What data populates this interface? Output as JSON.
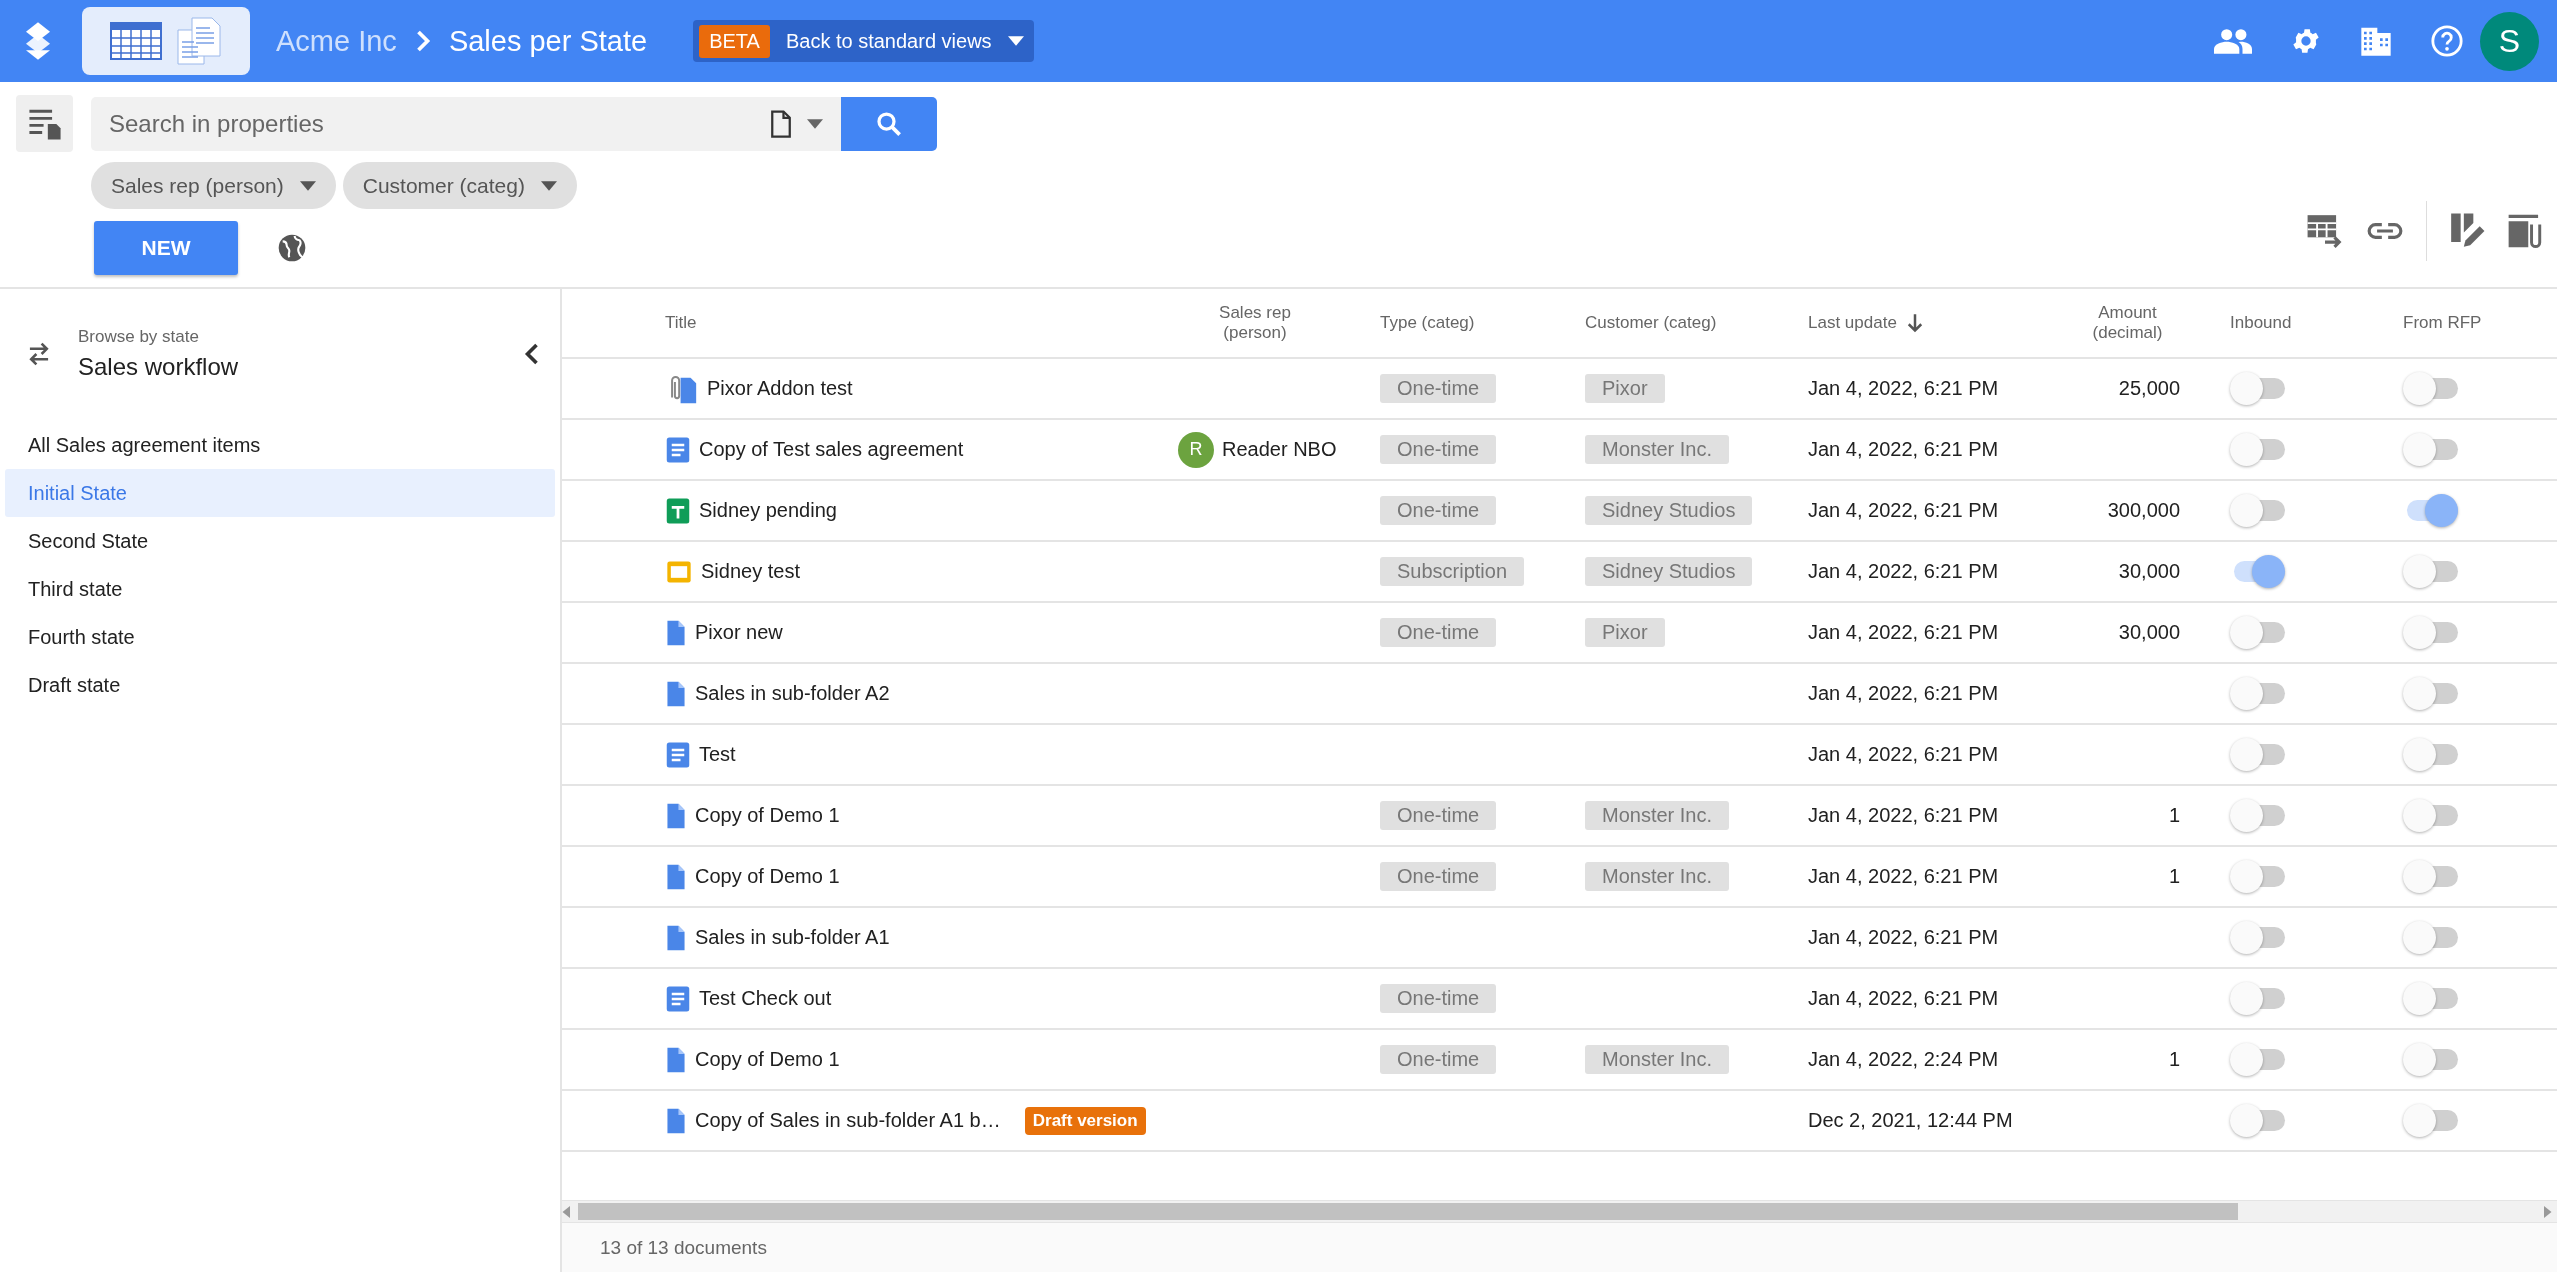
{
  "header": {
    "app_name": "Acme Inc",
    "view_title": "Sales per State",
    "beta_label": "BETA",
    "view_switch": "Back to standard views",
    "avatar_initial": "S"
  },
  "search": {
    "placeholder": "Search in properties"
  },
  "filters": [
    "Sales rep (person)",
    "Customer (categ)"
  ],
  "new_button": "NEW",
  "sidebar": {
    "caption": "Browse by state",
    "title": "Sales workflow",
    "items": [
      {
        "label": "All Sales agreement items",
        "selected": false
      },
      {
        "label": "Initial State",
        "selected": true
      },
      {
        "label": "Second State",
        "selected": false
      },
      {
        "label": "Third state",
        "selected": false
      },
      {
        "label": "Fourth state",
        "selected": false
      },
      {
        "label": "Draft state",
        "selected": false
      }
    ]
  },
  "table": {
    "columns": [
      {
        "label": "Title",
        "sorted": false
      },
      {
        "label": "Sales rep (person)",
        "sorted": false
      },
      {
        "label": "Type (categ)",
        "sorted": false
      },
      {
        "label": "Customer (categ)",
        "sorted": false
      },
      {
        "label": "Last update",
        "sorted": true
      },
      {
        "label": "Amount (decimal)",
        "sorted": false
      },
      {
        "label": "Inbound",
        "sorted": false
      },
      {
        "label": "From RFP",
        "sorted": false
      }
    ],
    "rows": [
      {
        "kind": "attached",
        "title": "Pixor Addon test",
        "type": "One-time",
        "customer": "Pixor",
        "last_update": "Jan 4, 2022, 6:21 PM",
        "amount": "25,000",
        "inbound": false,
        "from_rfp": false
      },
      {
        "kind": "doc",
        "title": "Copy of Test sales agreement",
        "sales_rep": {
          "initial": "R",
          "name": "Reader NBO"
        },
        "type": "One-time",
        "customer": "Monster Inc.",
        "last_update": "Jan 4, 2022, 6:21 PM",
        "inbound": false,
        "from_rfp": false
      },
      {
        "kind": "sheet",
        "title": "Sidney pending",
        "type": "One-time",
        "customer": "Sidney Studios",
        "last_update": "Jan 4, 2022, 6:21 PM",
        "amount": "300,000",
        "inbound": false,
        "from_rfp": true
      },
      {
        "kind": "slides",
        "title": "Sidney test",
        "type": "Subscription",
        "customer": "Sidney Studios",
        "last_update": "Jan 4, 2022, 6:21 PM",
        "amount": "30,000",
        "inbound": true,
        "from_rfp": false
      },
      {
        "kind": "file",
        "title": "Pixor new",
        "type": "One-time",
        "customer": "Pixor",
        "last_update": "Jan 4, 2022, 6:21 PM",
        "amount": "30,000",
        "inbound": false,
        "from_rfp": false
      },
      {
        "kind": "file",
        "title": "Sales in sub-folder A2",
        "last_update": "Jan 4, 2022, 6:21 PM",
        "inbound": false,
        "from_rfp": false
      },
      {
        "kind": "doc",
        "title": "Test",
        "last_update": "Jan 4, 2022, 6:21 PM",
        "inbound": false,
        "from_rfp": false
      },
      {
        "kind": "file",
        "title": "Copy of Demo 1",
        "type": "One-time",
        "customer": "Monster Inc.",
        "last_update": "Jan 4, 2022, 6:21 PM",
        "amount": "1",
        "inbound": false,
        "from_rfp": false
      },
      {
        "kind": "file",
        "title": "Copy of Demo 1",
        "type": "One-time",
        "customer": "Monster Inc.",
        "last_update": "Jan 4, 2022, 6:21 PM",
        "amount": "1",
        "inbound": false,
        "from_rfp": false
      },
      {
        "kind": "file",
        "title": "Sales in sub-folder A1",
        "last_update": "Jan 4, 2022, 6:21 PM",
        "inbound": false,
        "from_rfp": false
      },
      {
        "kind": "doc",
        "title": "Test Check out",
        "type": "One-time",
        "last_update": "Jan 4, 2022, 6:21 PM",
        "inbound": false,
        "from_rfp": false
      },
      {
        "kind": "file",
        "title": "Copy of Demo 1",
        "type": "One-time",
        "customer": "Monster Inc.",
        "last_update": "Jan 4, 2022, 2:24 PM",
        "amount": "1",
        "inbound": false,
        "from_rfp": false
      },
      {
        "kind": "file",
        "title": "Copy of Sales in sub-folder A1 b…",
        "badge": "Draft version",
        "last_update": "Dec 2, 2021, 12:44 PM",
        "inbound": false,
        "from_rfp": false
      }
    ]
  },
  "footer": {
    "count": "13 of 13 documents"
  }
}
